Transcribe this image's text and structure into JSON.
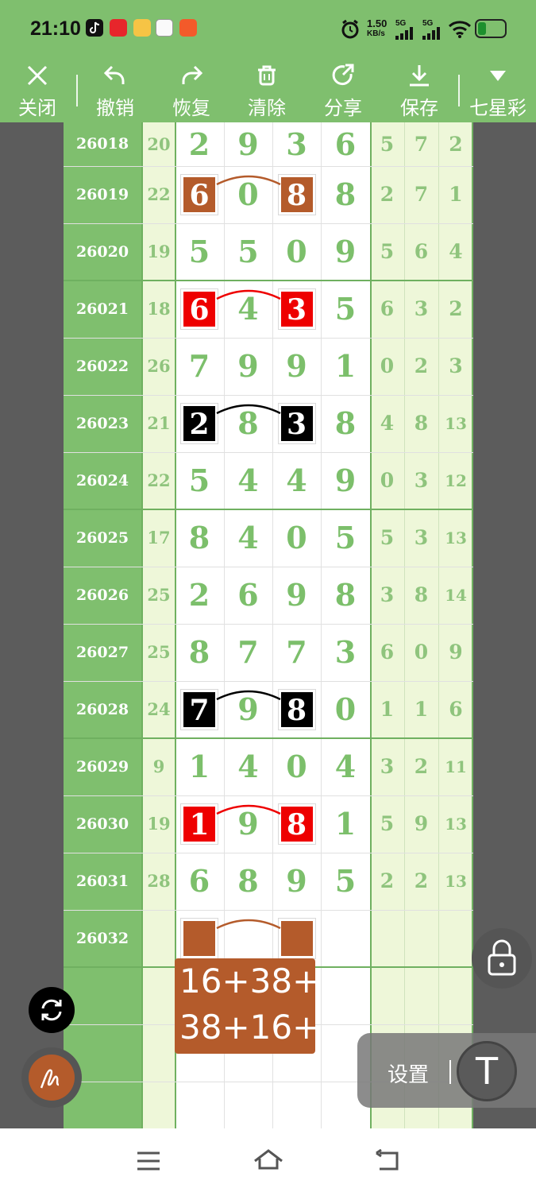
{
  "status_bar": {
    "time": "21:10",
    "net_speed": "1.50",
    "net_unit": "KB/s",
    "signal1": "5G",
    "signal2": "5G"
  },
  "toolbar": {
    "close": "关闭",
    "undo": "撤销",
    "redo": "恢复",
    "clear": "清除",
    "share": "分享",
    "save": "保存",
    "lottery": "七星彩"
  },
  "rows": [
    {
      "period": "26018",
      "sum": "20",
      "digits": [
        "2",
        "9",
        "3",
        "6"
      ],
      "extra": [
        "5",
        "7",
        "2"
      ]
    },
    {
      "period": "26019",
      "sum": "22",
      "digits": [
        "6",
        "0",
        "8",
        "8"
      ],
      "extra": [
        "2",
        "7",
        "1"
      ]
    },
    {
      "period": "26020",
      "sum": "19",
      "digits": [
        "5",
        "5",
        "0",
        "9"
      ],
      "extra": [
        "5",
        "6",
        "4"
      ]
    },
    {
      "period": "26021",
      "sum": "18",
      "digits": [
        "6",
        "4",
        "3",
        "5"
      ],
      "extra": [
        "6",
        "3",
        "2"
      ]
    },
    {
      "period": "26022",
      "sum": "26",
      "digits": [
        "7",
        "9",
        "9",
        "1"
      ],
      "extra": [
        "0",
        "2",
        "3"
      ]
    },
    {
      "period": "26023",
      "sum": "21",
      "digits": [
        "2",
        "8",
        "3",
        "8"
      ],
      "extra": [
        "4",
        "8",
        "13"
      ]
    },
    {
      "period": "26024",
      "sum": "22",
      "digits": [
        "5",
        "4",
        "4",
        "9"
      ],
      "extra": [
        "0",
        "3",
        "12"
      ]
    },
    {
      "period": "26025",
      "sum": "17",
      "digits": [
        "8",
        "4",
        "0",
        "5"
      ],
      "extra": [
        "5",
        "3",
        "13"
      ]
    },
    {
      "period": "26026",
      "sum": "25",
      "digits": [
        "2",
        "6",
        "9",
        "8"
      ],
      "extra": [
        "3",
        "8",
        "14"
      ]
    },
    {
      "period": "26027",
      "sum": "25",
      "digits": [
        "8",
        "7",
        "7",
        "3"
      ],
      "extra": [
        "6",
        "0",
        "9"
      ]
    },
    {
      "period": "26028",
      "sum": "24",
      "digits": [
        "7",
        "9",
        "8",
        "0"
      ],
      "extra": [
        "1",
        "1",
        "6"
      ]
    },
    {
      "period": "26029",
      "sum": "9",
      "digits": [
        "1",
        "4",
        "0",
        "4"
      ],
      "extra": [
        "3",
        "2",
        "11"
      ]
    },
    {
      "period": "26030",
      "sum": "19",
      "digits": [
        "1",
        "9",
        "8",
        "1"
      ],
      "extra": [
        "5",
        "9",
        "13"
      ]
    },
    {
      "period": "26031",
      "sum": "28",
      "digits": [
        "6",
        "8",
        "9",
        "5"
      ],
      "extra": [
        "2",
        "2",
        "13"
      ]
    },
    {
      "period": "26032",
      "sum": "",
      "digits": [
        "",
        "",
        "",
        ""
      ],
      "extra": [
        "",
        "",
        ""
      ]
    }
  ],
  "highlights": [
    {
      "row": 1,
      "color": "#b45b2b"
    },
    {
      "row": 3,
      "color": "#ee0000"
    },
    {
      "row": 5,
      "color": "#000000"
    },
    {
      "row": 10,
      "color": "#000000"
    },
    {
      "row": 12,
      "color": "#ee0000"
    },
    {
      "row": 14,
      "color": "#b45b2b"
    }
  ],
  "prediction": {
    "line1": "16+38+",
    "line2": "38+16+"
  },
  "settings_label": "设置",
  "text_tool_label": "T",
  "colors": {
    "accent_green": "#7fbf6e",
    "digit_green": "#7cbf6b",
    "brown": "#b45b2b",
    "red": "#ee0000",
    "black": "#000000"
  }
}
